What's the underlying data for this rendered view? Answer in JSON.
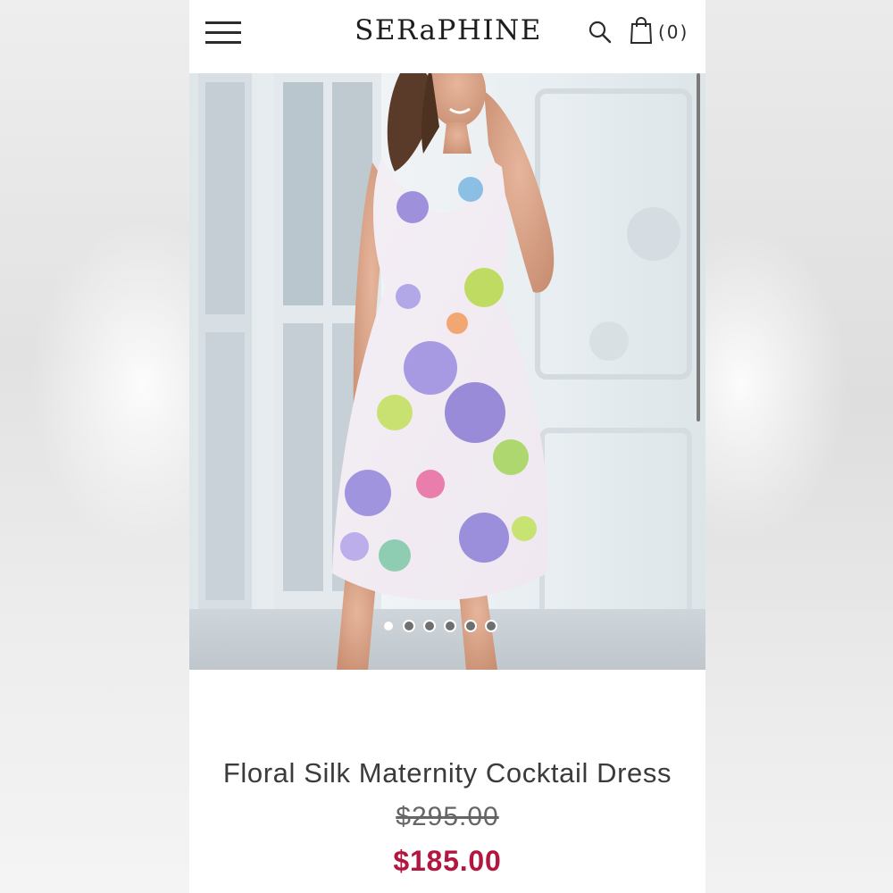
{
  "header": {
    "logo_text": "SERaPHINE",
    "menu_icon": "hamburger-menu-icon",
    "search_icon": "search-icon",
    "bag_icon": "shopping-bag-icon",
    "bag_count": "(0)"
  },
  "gallery": {
    "image_alt_subject": "model-in-floral-dress-photo",
    "dots_total": 6,
    "active_dot_index": 0
  },
  "product": {
    "title": "Floral Silk Maternity Cocktail Dress",
    "original_price": "$295.00",
    "sale_price": "$185.00"
  },
  "colors": {
    "sale_price": "#b3173f",
    "text_primary": "#3b3b3b"
  }
}
